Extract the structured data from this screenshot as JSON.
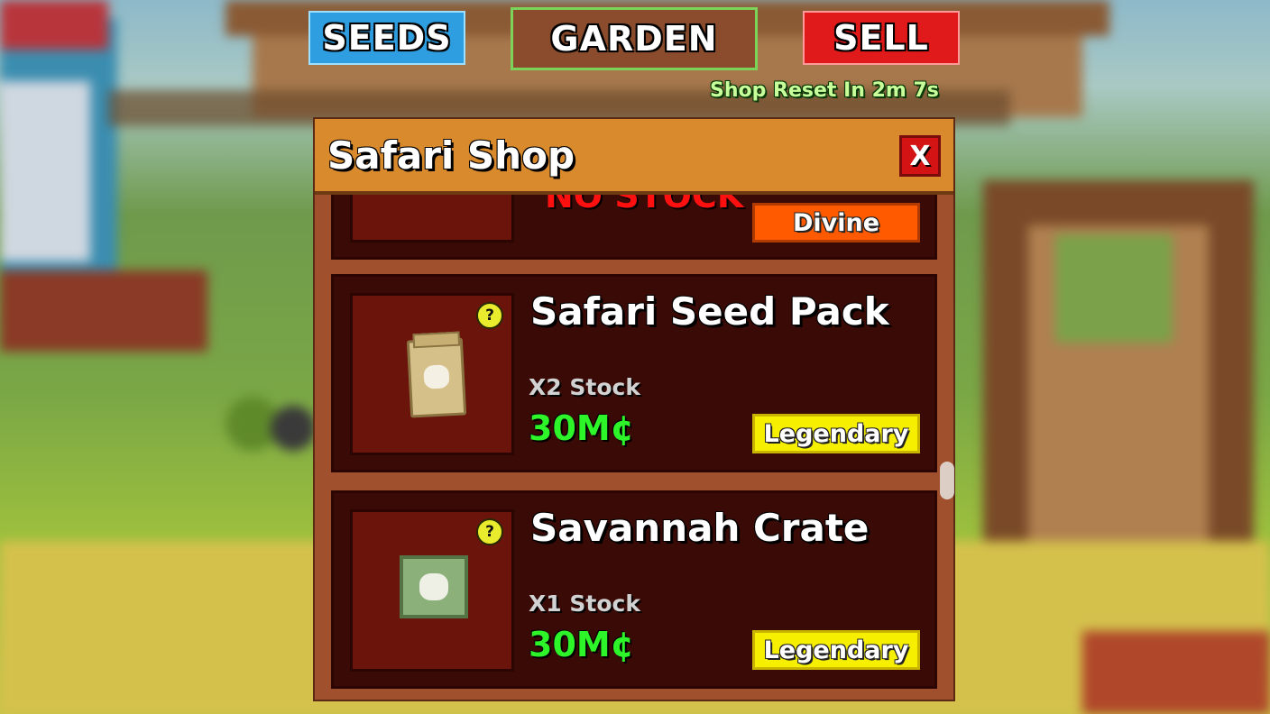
{
  "tabs": {
    "seeds": "SEEDS",
    "garden": "GARDEN",
    "sell": "SELL"
  },
  "shop_reset": "Shop Reset In 2m 7s",
  "shop": {
    "title": "Safari Shop",
    "close_label": "X",
    "items": [
      {
        "name": "",
        "stock_text": "NO STOCK",
        "rarity": "Divine",
        "icon": "unknown-item-icon"
      },
      {
        "name": "Safari Seed Pack",
        "stock_text": "X2 Stock",
        "price": "30M¢",
        "rarity": "Legendary",
        "icon": "seed-pack-icon"
      },
      {
        "name": "Savannah Crate",
        "stock_text": "X1 Stock",
        "price": "30M¢",
        "rarity": "Legendary",
        "icon": "crate-icon"
      }
    ],
    "help_label": "?"
  },
  "colors": {
    "legendary": "#f6f000",
    "divine": "#ff5a00",
    "price": "#2ef52a",
    "no_stock": "#ff1010"
  }
}
